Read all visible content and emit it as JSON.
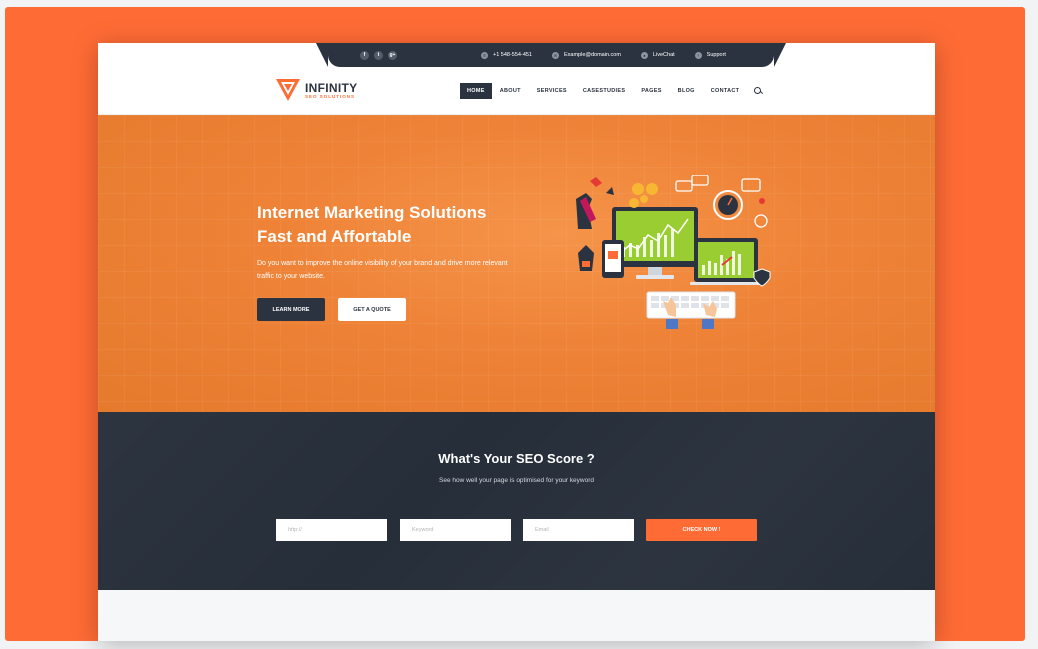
{
  "topbar": {
    "social": [
      "f",
      "t",
      "g+"
    ],
    "phone": "+1 548-554-451",
    "email": "Example@domain.com",
    "livechat": "LiveChat",
    "support": "Support"
  },
  "logo": {
    "name": "INFINITY",
    "tagline": "SEO SOLUTIONS"
  },
  "nav": {
    "items": [
      "HOME",
      "ABOUT",
      "SERVICES",
      "CASESTUDIES",
      "PAGES",
      "BLOG",
      "CONTACT"
    ],
    "active": "HOME"
  },
  "hero": {
    "title_line1": "Internet Marketing Solutions",
    "title_line2": "Fast and Affortable",
    "subtitle": "Do you want to improve the online visibility of your brand and drive more relevant traffic to your website.",
    "btn_primary": "LEARN MORE",
    "btn_secondary": "GET A QUOTE"
  },
  "seo": {
    "title": "What's Your SEO Score ?",
    "subtitle": "See how well your page is optimised for your keyword",
    "url_placeholder": "http://",
    "keyword_placeholder": "Keyword",
    "email_placeholder": "Email",
    "button": "CHECK NOW !"
  },
  "colors": {
    "accent": "#ff6b35",
    "dark": "#2b3340",
    "hero": "#ee8236"
  }
}
